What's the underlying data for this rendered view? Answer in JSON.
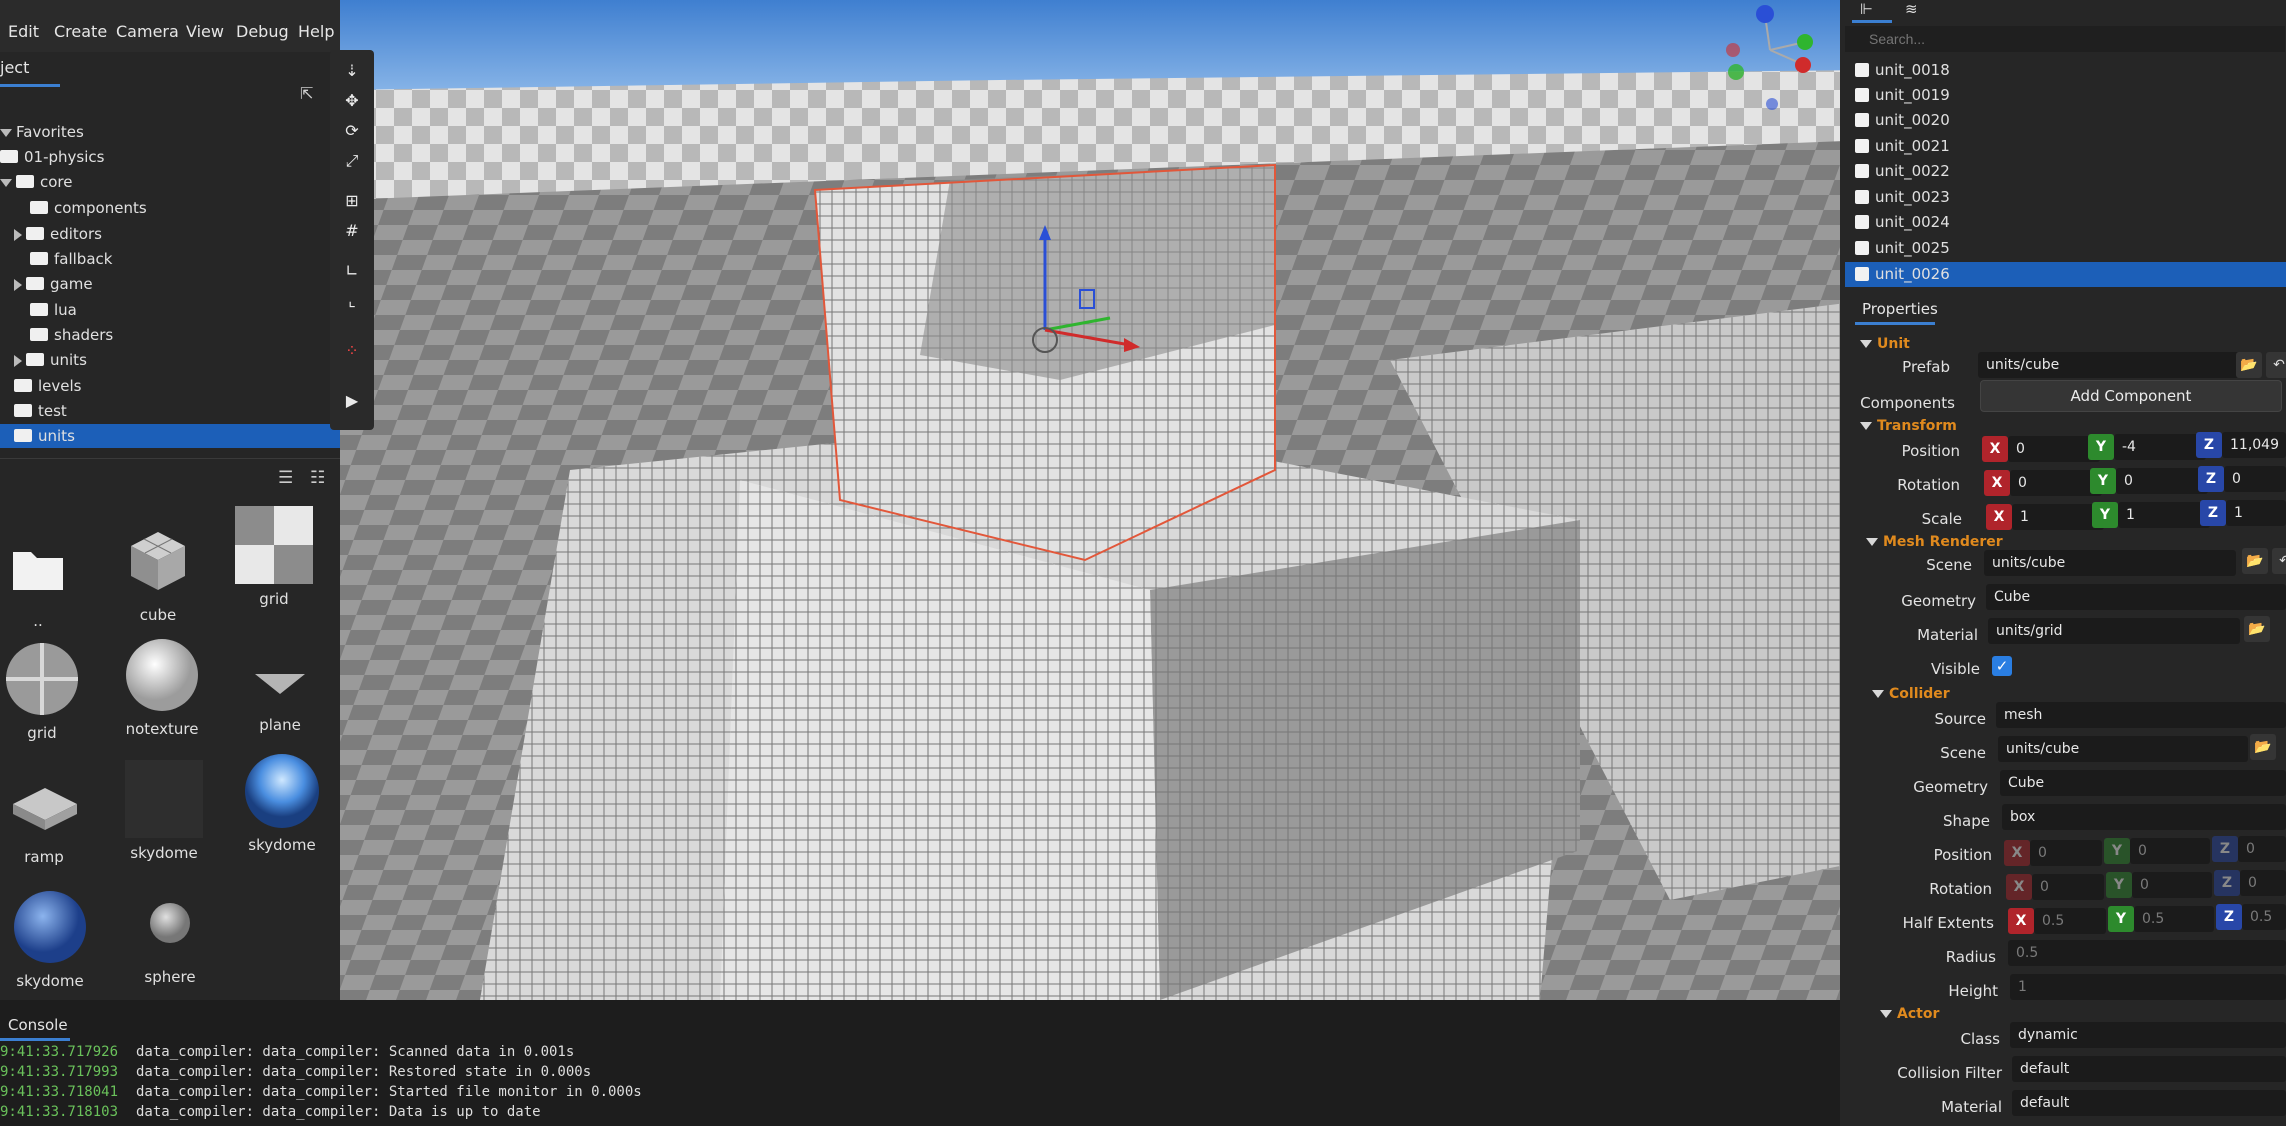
{
  "menu": [
    "Edit",
    "Create",
    "Camera",
    "View",
    "Debug",
    "Help"
  ],
  "project_tab": "ject",
  "tree": [
    {
      "label": "Favorites",
      "indent": 0,
      "arrow": "down",
      "folder": false
    },
    {
      "label": "01-physics",
      "indent": 0,
      "arrow": "none",
      "folder": true
    },
    {
      "label": "core",
      "indent": 0,
      "arrow": "down",
      "folder": true
    },
    {
      "label": "components",
      "indent": 1,
      "arrow": "none",
      "folder": true
    },
    {
      "label": "editors",
      "indent": 1,
      "arrow": "right",
      "folder": true
    },
    {
      "label": "fallback",
      "indent": 1,
      "arrow": "none",
      "folder": true
    },
    {
      "label": "game",
      "indent": 1,
      "arrow": "right",
      "folder": true
    },
    {
      "label": "lua",
      "indent": 1,
      "arrow": "none",
      "folder": true
    },
    {
      "label": "shaders",
      "indent": 1,
      "arrow": "none",
      "folder": true
    },
    {
      "label": "units",
      "indent": 1,
      "arrow": "right",
      "folder": true
    },
    {
      "label": "levels",
      "indent": 0,
      "arrow": "none",
      "folder": true
    },
    {
      "label": "test",
      "indent": 0,
      "arrow": "none",
      "folder": true
    },
    {
      "label": "units",
      "indent": 0,
      "arrow": "none",
      "folder": true,
      "selected": true
    }
  ],
  "assets": [
    {
      "label": "..",
      "kind": "folder"
    },
    {
      "label": "cube",
      "kind": "cube"
    },
    {
      "label": "grid",
      "kind": "grid"
    },
    {
      "label": "grid",
      "kind": "grid-sphere"
    },
    {
      "label": "notexture",
      "kind": "white-sphere"
    },
    {
      "label": "plane",
      "kind": "plane"
    },
    {
      "label": "ramp",
      "kind": "ramp"
    },
    {
      "label": "skydome",
      "kind": "blank"
    },
    {
      "label": "skydome",
      "kind": "sky-sphere"
    },
    {
      "label": "skydome",
      "kind": "blue-sphere"
    },
    {
      "label": "sphere",
      "kind": "small-sphere"
    }
  ],
  "console": {
    "tab": "Console",
    "rows": [
      {
        "time": "9:41:33.717926",
        "msg": "data_compiler: data_compiler: Scanned data in 0.001s"
      },
      {
        "time": "9:41:33.717993",
        "msg": "data_compiler: data_compiler: Restored state in 0.000s"
      },
      {
        "time": "9:41:33.718041",
        "msg": "data_compiler: data_compiler: Started file monitor in 0.000s"
      },
      {
        "time": "9:41:33.718103",
        "msg": "data_compiler: data_compiler: Data is up to date"
      }
    ]
  },
  "scene_tree": {
    "search_placeholder": "Search...",
    "units": [
      "unit_0018",
      "unit_0019",
      "unit_0020",
      "unit_0021",
      "unit_0022",
      "unit_0023",
      "unit_0024",
      "unit_0025",
      "unit_0026"
    ],
    "selected": "unit_0026"
  },
  "properties": {
    "tab": "Properties",
    "unit": {
      "section": "Unit",
      "prefab_label": "Prefab",
      "prefab": "units/cube",
      "components_label": "Components",
      "add_component": "Add Component"
    },
    "transform": {
      "section": "Transform",
      "position_label": "Position",
      "position": [
        "0",
        "-4",
        "11,049"
      ],
      "rotation_label": "Rotation",
      "rotation": [
        "0",
        "0",
        "0"
      ],
      "scale_label": "Scale",
      "scale": [
        "1",
        "1",
        "1"
      ]
    },
    "mesh_renderer": {
      "section": "Mesh Renderer",
      "scene_label": "Scene",
      "scene": "units/cube",
      "geometry_label": "Geometry",
      "geometry": "Cube",
      "material_label": "Material",
      "material": "units/grid",
      "visible_label": "Visible",
      "visible": true
    },
    "collider": {
      "section": "Collider",
      "source_label": "Source",
      "source": "mesh",
      "scene_label": "Scene",
      "scene": "units/cube",
      "geometry_label": "Geometry",
      "geometry": "Cube",
      "shape_label": "Shape",
      "shape": "box",
      "position_label": "Position",
      "position": [
        "0",
        "0",
        "0"
      ],
      "rotation_label": "Rotation",
      "rotation": [
        "0",
        "0",
        "0"
      ],
      "half_extents_label": "Half Extents",
      "half_extents": [
        "0.5",
        "0.5",
        "0.5"
      ],
      "radius_label": "Radius",
      "radius": "0.5",
      "height_label": "Height",
      "height": "1"
    },
    "actor": {
      "section": "Actor",
      "class_label": "Class",
      "class": "dynamic",
      "collision_filter_label": "Collision Filter",
      "collision_filter": "default",
      "material_label": "Material",
      "material": "default"
    }
  },
  "colors": {
    "accent": "#1c5fb8",
    "section": "#e08a1e",
    "axis_x": "#b0242b",
    "axis_y": "#2d8a2d",
    "axis_z": "#2847a8"
  }
}
